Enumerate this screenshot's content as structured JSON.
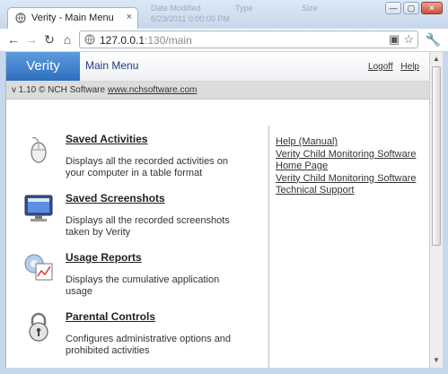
{
  "browser": {
    "tab_title": "Verity - Main Menu",
    "tab_close": "×",
    "url_host": "127.0.0.1",
    "url_rest": ":130/main",
    "background_text": [
      "Date Modified",
      "Type",
      "Size",
      "6/23/2011 0:00:00 PM"
    ],
    "window_buttons": {
      "minimize": "—",
      "maximize": "▢",
      "close": "✕"
    }
  },
  "app": {
    "brand": "Verity",
    "menu_title": "Main Menu",
    "links": {
      "logoff": "Logoff",
      "help": "Help"
    },
    "version": "v 1.10 © NCH Software",
    "website": "www.nchsoftware.com"
  },
  "items": [
    {
      "title": "Saved Activities",
      "desc": "Displays all the recorded activities on your computer in a table format",
      "icon": "mouse-icon"
    },
    {
      "title": "Saved Screenshots",
      "desc": "Displays all the recorded screenshots taken by Verity",
      "icon": "monitor-icon"
    },
    {
      "title": "Usage Reports",
      "desc": "Displays the cumulative application usage",
      "icon": "report-chart-icon"
    },
    {
      "title": "Parental Controls",
      "desc": "Configures administrative options and prohibited activities",
      "icon": "padlock-icon"
    }
  ],
  "right_links": [
    "Help (Manual)",
    "Verity Child Monitoring Software Home Page",
    "Verity Child Monitoring Software Technical Support"
  ],
  "colors": {
    "brand_blue": "#2d6fc0",
    "chrome_blue": "#c7d7ec"
  }
}
